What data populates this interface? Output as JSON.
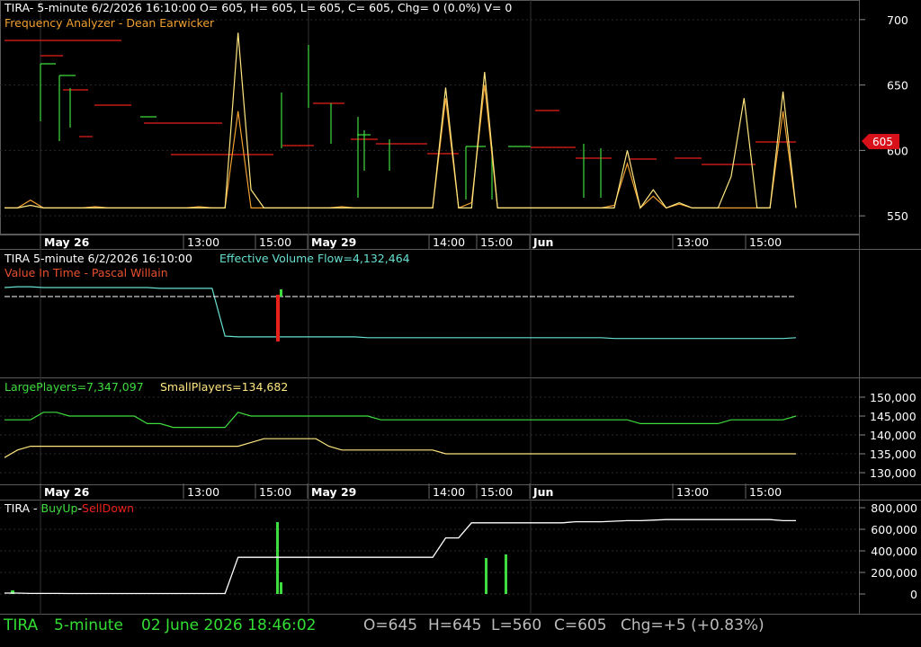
{
  "colors": {
    "background": "#000000",
    "grid": "#2a2a2a",
    "axis_text": "#ffffff",
    "panel_border": "#5a5a5a",
    "green": "#3fdc3f",
    "red": "#e8201a",
    "yellow": "#ffe680",
    "orange": "#f0a030",
    "cyan": "#66e0d0",
    "white": "#ffffff",
    "status_green": "#33dd33",
    "status_gray": "#bbbbbb",
    "price_tag_bg": "#d8101a"
  },
  "panel1": {
    "header_line1": "TIRA- 5-minute 6/2/2026 16:10:00 O= 605, H= 605, L= 605, C= 605, Chg= 0 (0.0%) V= 0",
    "header_line2": "Frequency Analyzer - Dean Earwicker",
    "price_tag": "605"
  },
  "panel2": {
    "header_a": "TIRA 5-minute  6/2/2026 16:10:00",
    "header_b": "Effective Volume Flow=4,132,464",
    "header_line2": "Value In Time - Pascal Willain"
  },
  "panel3": {
    "large_label": "LargePlayers=7,347,097",
    "small_label": "SmallPlayers=134,682"
  },
  "panel4": {
    "prefix": "TIRA - ",
    "buy": "BuyUp",
    "dash": "-",
    "sell": "SellDown"
  },
  "time_axis": [
    "May 26",
    "13:00",
    "15:00",
    "May 29",
    "14:00",
    "15:00",
    "Jun",
    "13:00",
    "15:00"
  ],
  "status_bar": {
    "symbol": "TIRA",
    "interval": "5-minute",
    "datetime": "02 June 2026 18:46:02",
    "open": "O=645",
    "high": "H=645",
    "low": "L=560",
    "close": "C=605",
    "change": "Chg=+5 (+0.83%)"
  },
  "chart_data": [
    {
      "type": "line",
      "title": "Frequency Analyzer - Dean Earwicker",
      "ylim": [
        535,
        715
      ],
      "y_ticks": [
        550,
        600,
        650,
        700
      ],
      "x": [
        0,
        2,
        4,
        6,
        8,
        10,
        12,
        14,
        16,
        18,
        20,
        22,
        24,
        26,
        28,
        30,
        32,
        34,
        35,
        36,
        37,
        38,
        40,
        42,
        44,
        46,
        48,
        50,
        52,
        54,
        56,
        58,
        60,
        62,
        63,
        64,
        65,
        66,
        67,
        68,
        69,
        70,
        72,
        74,
        76,
        78,
        80,
        82,
        84,
        86,
        88,
        90,
        92,
        94,
        96,
        98,
        100,
        102,
        104,
        106,
        108,
        110
      ],
      "series": [
        {
          "color_key": "orange",
          "values": [
            556,
            556,
            562,
            556,
            556,
            556,
            556,
            557,
            556,
            556,
            556,
            556,
            556,
            556,
            556,
            557,
            556,
            556,
            630,
            556,
            556,
            556,
            556,
            556,
            556,
            556,
            557,
            556,
            556,
            556,
            556,
            556,
            556,
            556,
            640,
            556,
            560,
            650,
            556,
            556,
            556,
            556,
            556,
            556,
            556,
            556,
            556,
            558,
            590,
            556,
            565,
            556,
            559,
            556,
            556,
            556,
            556,
            556,
            556,
            556,
            630,
            556
          ]
        },
        {
          "color_key": "yellow",
          "values": [
            556,
            556,
            558,
            556,
            556,
            556,
            556,
            556,
            556,
            556,
            556,
            556,
            556,
            556,
            556,
            556,
            556,
            556,
            690,
            570,
            556,
            556,
            556,
            556,
            556,
            556,
            556,
            556,
            556,
            556,
            556,
            556,
            556,
            556,
            648,
            556,
            556,
            660,
            556,
            556,
            556,
            556,
            556,
            556,
            556,
            556,
            556,
            556,
            600,
            556,
            570,
            556,
            560,
            556,
            556,
            556,
            580,
            640,
            556,
            556,
            645,
            556
          ]
        }
      ]
    },
    {
      "type": "line",
      "title": "Effective Volume Flow=4,132,464",
      "series": [
        {
          "name": "Effective Volume Flow",
          "color_key": "cyan",
          "values": [
            100,
            101,
            101,
            100,
            100,
            100,
            100,
            100,
            100,
            100,
            100,
            100,
            99,
            99,
            99,
            99,
            99,
            40,
            39,
            39,
            39,
            39,
            39,
            39,
            39,
            39,
            39,
            39,
            38,
            38,
            38,
            38,
            38,
            38,
            38,
            38,
            38,
            38,
            38,
            38,
            38,
            38,
            38,
            38,
            38,
            38,
            38,
            37,
            37,
            37,
            37,
            37,
            37,
            37,
            37,
            37,
            37,
            37,
            37,
            37,
            37,
            38
          ]
        },
        {
          "name": "Value In Time",
          "color_key": "white",
          "values": [
            93,
            93,
            93,
            93,
            93,
            93,
            93,
            93,
            93,
            93,
            93,
            93,
            93,
            93,
            93,
            93,
            93,
            93,
            93,
            93,
            93,
            93,
            93,
            93,
            93,
            93,
            93,
            93,
            93,
            93,
            93,
            93,
            93,
            93,
            93,
            93,
            93,
            93,
            93,
            93,
            93,
            93,
            93,
            93,
            93,
            93,
            93,
            93,
            93,
            93,
            93,
            93,
            93,
            93,
            93,
            93,
            93,
            93,
            93,
            93,
            93,
            93
          ]
        }
      ]
    },
    {
      "type": "line",
      "title": "LargePlayers / SmallPlayers",
      "ylim": [
        126000,
        153000
      ],
      "y_ticks": [
        130000,
        135000,
        140000,
        145000,
        150000
      ],
      "series": [
        {
          "name": "LargePlayers",
          "color_key": "green",
          "values": [
            144,
            144,
            144,
            146,
            146,
            145,
            145,
            145,
            145,
            145,
            145,
            143,
            143,
            142,
            142,
            142,
            142,
            142,
            146,
            145,
            145,
            145,
            145,
            145,
            145,
            145,
            145,
            145,
            145,
            144,
            144,
            144,
            144,
            144,
            144,
            144,
            144,
            144,
            144,
            144,
            144,
            144,
            144,
            144,
            144,
            144,
            144,
            144,
            144,
            143,
            143,
            143,
            143,
            143,
            143,
            143,
            144,
            144,
            144,
            144,
            144,
            145
          ]
        },
        {
          "name": "SmallPlayers",
          "color_key": "yellow",
          "values": [
            134,
            136,
            137,
            137,
            137,
            137,
            137,
            137,
            137,
            137,
            137,
            137,
            137,
            137,
            137,
            137,
            137,
            137,
            137,
            138,
            139,
            139,
            139,
            139,
            139,
            137,
            136,
            136,
            136,
            136,
            136,
            136,
            136,
            136,
            135,
            135,
            135,
            135,
            135,
            135,
            135,
            135,
            135,
            135,
            135,
            135,
            135,
            135,
            135,
            135,
            135,
            135,
            135,
            135,
            135,
            135,
            135,
            135,
            135,
            135,
            135,
            135
          ]
        }
      ]
    },
    {
      "type": "line",
      "title": "TIRA - BuyUp-SellDown",
      "ylim": [
        -30000,
        850000
      ],
      "y_ticks": [
        0,
        200000,
        400000,
        600000,
        800000
      ],
      "series": [
        {
          "name": "BuyUp-SellDown",
          "color_key": "white",
          "values": [
            8000,
            8000,
            5000,
            5000,
            5000,
            4000,
            4000,
            4000,
            4000,
            4000,
            4000,
            4000,
            4000,
            4000,
            4000,
            4000,
            4000,
            4000,
            340000,
            340000,
            340000,
            340000,
            340000,
            340000,
            340000,
            340000,
            340000,
            340000,
            340000,
            340000,
            340000,
            340000,
            340000,
            340000,
            520000,
            520000,
            660000,
            660000,
            660000,
            660000,
            660000,
            660000,
            660000,
            660000,
            670000,
            670000,
            670000,
            675000,
            680000,
            680000,
            685000,
            690000,
            690000,
            690000,
            690000,
            690000,
            690000,
            690000,
            690000,
            690000,
            680000,
            680000
          ]
        }
      ]
    }
  ]
}
